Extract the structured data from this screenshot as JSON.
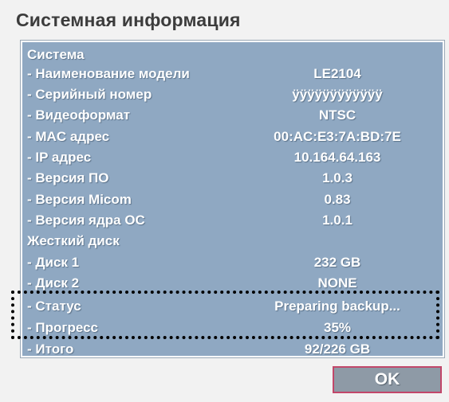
{
  "dialog": {
    "title": "Системная информация"
  },
  "panel_color": "#8fa8c2",
  "rows": [
    {
      "label": "Система",
      "value": ""
    },
    {
      "label": "- Наименование модели",
      "value": "LE2104"
    },
    {
      "label": "- Серийный номер",
      "value": "ÿÿÿÿÿÿÿÿÿÿÿÿ"
    },
    {
      "label": "- Видеоформат",
      "value": "NTSC"
    },
    {
      "label": "- MAC адрес",
      "value": "00:AC:E3:7A:BD:7E"
    },
    {
      "label": "- IP адрес",
      "value": "10.164.64.163"
    },
    {
      "label": "- Версия ПО",
      "value": "1.0.3"
    },
    {
      "label": "- Версия Micom",
      "value": "0.83"
    },
    {
      "label": "- Версия ядра ОС",
      "value": "1.0.1"
    },
    {
      "label": "Жесткий диск",
      "value": ""
    },
    {
      "label": "- Диск 1",
      "value": "232 GB"
    },
    {
      "label": "- Диск 2",
      "value": "NONE"
    },
    {
      "label": "- Статус",
      "value": "Preparing backup..."
    },
    {
      "label": "- Прогресс",
      "value": "35%"
    },
    {
      "label": "- Итого",
      "value": "92/226 GB"
    }
  ],
  "buttons": {
    "ok_label": "OK"
  }
}
